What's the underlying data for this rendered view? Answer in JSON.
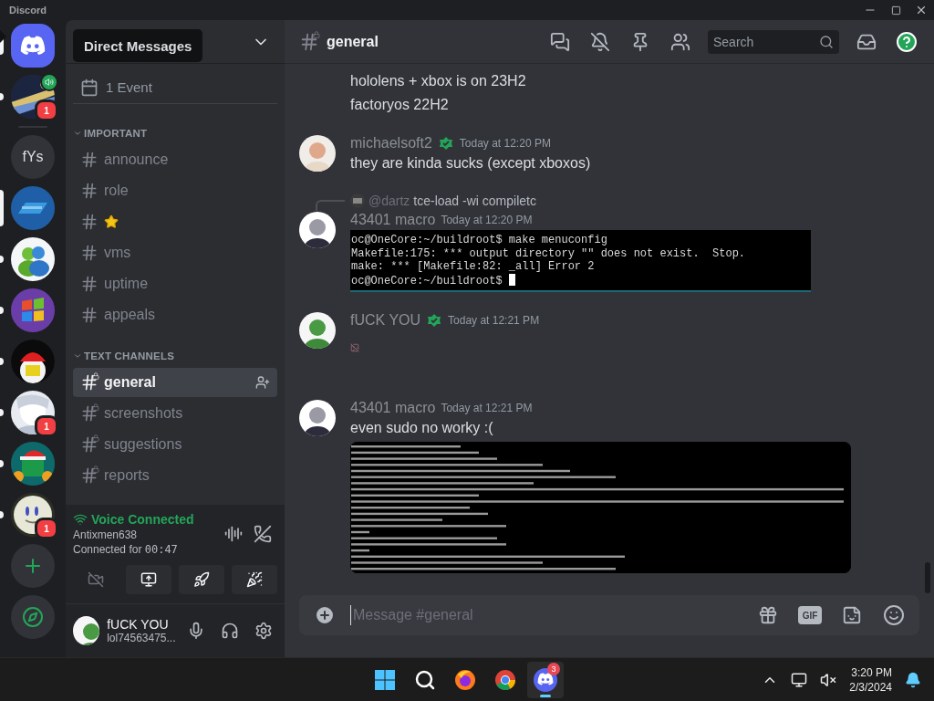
{
  "window": {
    "title": "Discord"
  },
  "tooltip": {
    "text": "Direct Messages"
  },
  "servers": [
    {
      "kind": "home",
      "hovered": true,
      "selected": false,
      "unread": false
    },
    {
      "kind": "picture",
      "hovered": false,
      "selected": false,
      "unread": true,
      "badge": "1",
      "voice": true
    },
    {
      "kind": "separator"
    },
    {
      "kind": "text",
      "label": "fYs",
      "hovered": false,
      "selected": false,
      "unread": false
    },
    {
      "kind": "picture",
      "hovered": false,
      "selected": true,
      "unread": false
    },
    {
      "kind": "picture",
      "hovered": false,
      "selected": false,
      "unread": true
    },
    {
      "kind": "picture",
      "hovered": false,
      "selected": false,
      "unread": true
    },
    {
      "kind": "picture",
      "hovered": false,
      "selected": false,
      "unread": true
    },
    {
      "kind": "picture",
      "hovered": false,
      "selected": false,
      "unread": true,
      "badge": "1"
    },
    {
      "kind": "picture",
      "hovered": false,
      "selected": false,
      "unread": true
    },
    {
      "kind": "picture",
      "hovered": false,
      "selected": false,
      "unread": true,
      "badge": "1"
    },
    {
      "kind": "add"
    },
    {
      "kind": "discover"
    }
  ],
  "sidebar": {
    "events": "1 Event",
    "categories": [
      {
        "name": "IMPORTANT",
        "expanded": true,
        "channels": [
          {
            "kind": "text",
            "name": "announce",
            "selected": false
          },
          {
            "kind": "text",
            "name": "role",
            "selected": false
          },
          {
            "kind": "emoji",
            "selected": false
          },
          {
            "kind": "text",
            "name": "vms",
            "selected": false
          },
          {
            "kind": "text",
            "name": "uptime",
            "selected": false
          },
          {
            "kind": "text",
            "name": "appeals",
            "selected": false
          }
        ]
      },
      {
        "name": "TEXT CHANNELS",
        "expanded": true,
        "channels": [
          {
            "kind": "locked",
            "name": "general",
            "selected": true
          },
          {
            "kind": "locked",
            "name": "screenshots",
            "selected": false
          },
          {
            "kind": "locked",
            "name": "suggestions",
            "selected": false
          },
          {
            "kind": "locked",
            "name": "reports",
            "selected": false
          }
        ]
      }
    ]
  },
  "voice": {
    "status": "Voice Connected",
    "channel": "Antixmen638",
    "duration_label": "Connected for ",
    "duration": "00:47"
  },
  "user": {
    "name": "fUCK YOU",
    "tag": "lol74563475..."
  },
  "channel_header": {
    "name": "general",
    "search_placeholder": "Search"
  },
  "messages": [
    {
      "kind": "text",
      "text": "hololens + xbox is on 23H2"
    },
    {
      "kind": "text",
      "text": "factoryos 22H2"
    },
    {
      "kind": "group",
      "author": "michaelsoft2",
      "badge": true,
      "time": "Today at 12:20 PM",
      "text": "they are kinda sucks (except xboxos)"
    },
    {
      "kind": "group",
      "reply": {
        "mention": "@dartz",
        "text": "tce-load -wi compiletc"
      },
      "author": "43401 macro",
      "badge": false,
      "time": "Today at 12:20 PM",
      "attachment": {
        "kind": "terminal_text",
        "lines": [
          "oc@OneCore:~/buildroot$ make menuconfig",
          "Makefile:175: *** output directory \"\" does not exist.  Stop.",
          "make: *** [Makefile:82: _all] Error 2",
          "oc@OneCore:~/buildroot$"
        ]
      }
    },
    {
      "kind": "group",
      "author": "fUCK YOU",
      "badge": true,
      "time": "Today at 12:21 PM",
      "attachment": {
        "kind": "broken_file"
      }
    },
    {
      "kind": "group",
      "author": "43401 macro",
      "badge": false,
      "time": "Today at 12:21 PM",
      "text": "even sudo no worky :(",
      "attachment": {
        "kind": "terminal_image"
      }
    }
  ],
  "composer": {
    "placeholder": "Message #general",
    "gif": "GIF"
  },
  "taskbar": {
    "apps": [
      {
        "kind": "start",
        "active": false
      },
      {
        "kind": "search",
        "active": false
      },
      {
        "kind": "firefox",
        "active": false
      },
      {
        "kind": "chrome",
        "active": false
      },
      {
        "kind": "discord",
        "active": true,
        "badge": "3"
      }
    ],
    "time": "3:20 PM",
    "date": "2/3/2024"
  }
}
